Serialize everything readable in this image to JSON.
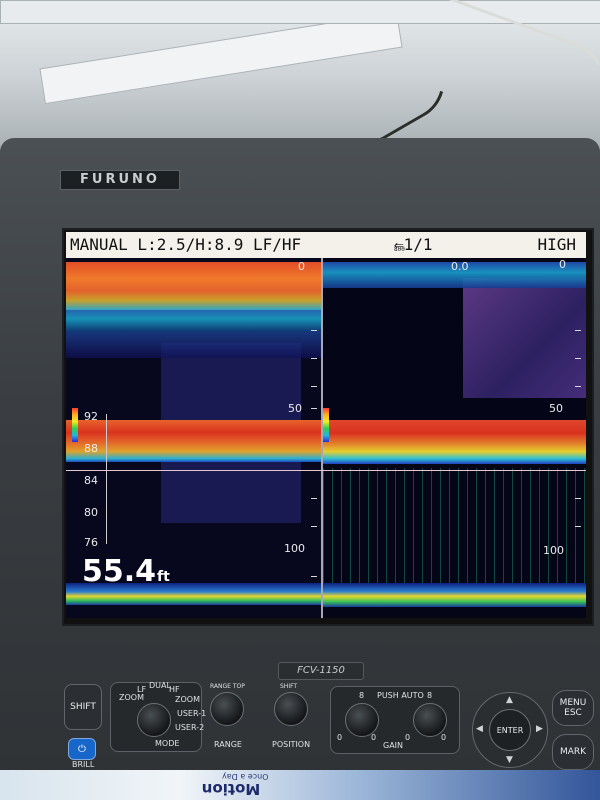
{
  "device": {
    "brand": "FURUNO",
    "model": "FCV-1150"
  },
  "status_bar": {
    "mode": "MANUAL L:2.5/H:8.9 LF/HF",
    "page": "1/1",
    "page_sub": "800",
    "range_mode": "HIGH"
  },
  "left_pane": {
    "top_depth": "0",
    "depth_50": "50",
    "depth_100": "100",
    "temp_labels": [
      "92",
      "88",
      "84",
      "80",
      "76"
    ]
  },
  "right_pane": {
    "top_left_value": "0.0",
    "top_depth": "0",
    "depth_50": "50",
    "depth_100": "100"
  },
  "depth_readout": {
    "value": "55.4",
    "unit": "ft"
  },
  "controls": {
    "shift": "SHIFT",
    "power": "⏻",
    "power_label": "BRILL",
    "mode_labels": {
      "lf": "LF",
      "dual": "DUAL",
      "hf": "HF",
      "zoom_left": "ZOOM",
      "zoom_right": "ZOOM",
      "user1": "USER-1",
      "user2": "USER-2",
      "mode": "MODE"
    },
    "range": "RANGE",
    "range_top": "RANGE TOP",
    "shift_knob": "SHIFT",
    "position": "POSITION",
    "gain_group": {
      "push_auto": "PUSH AUTO",
      "gain": "GAIN",
      "left_max": "8",
      "right_max": "8",
      "left_min": "0",
      "right_min": "0",
      "left_zero": "0",
      "right_zero": "0"
    },
    "menu": "MENU\nESC",
    "enter": "ENTER",
    "mark": "MARK"
  },
  "foreground_label": "Motion",
  "foreground_sub": "Once a Day"
}
